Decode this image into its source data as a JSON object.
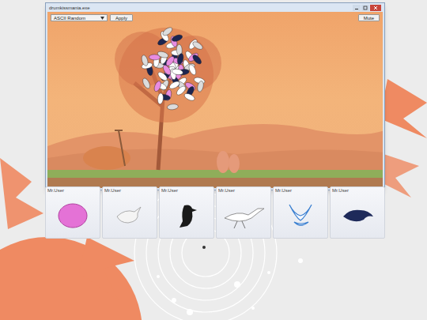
{
  "window": {
    "title": "drumkissmania.exe"
  },
  "toolbar": {
    "dropdown": {
      "value": "ASCII Random"
    },
    "apply_button": "Apply",
    "mute_button": "Mute"
  },
  "players": [
    {
      "label": "Mr.User",
      "kind": "blob",
      "color": "#e472d6"
    },
    {
      "label": "Mr.User",
      "kind": "bird",
      "color": "#f4f4f4"
    },
    {
      "label": "Mr.User",
      "kind": "crow",
      "color": "#1a1a1a"
    },
    {
      "label": "Mr.User",
      "kind": "heron",
      "color": "#ffffff"
    },
    {
      "label": "Mr.User",
      "kind": "dove",
      "color": "#3a7fd0"
    },
    {
      "label": "Mr.User",
      "kind": "raven",
      "color": "#1e2a5a"
    }
  ]
}
